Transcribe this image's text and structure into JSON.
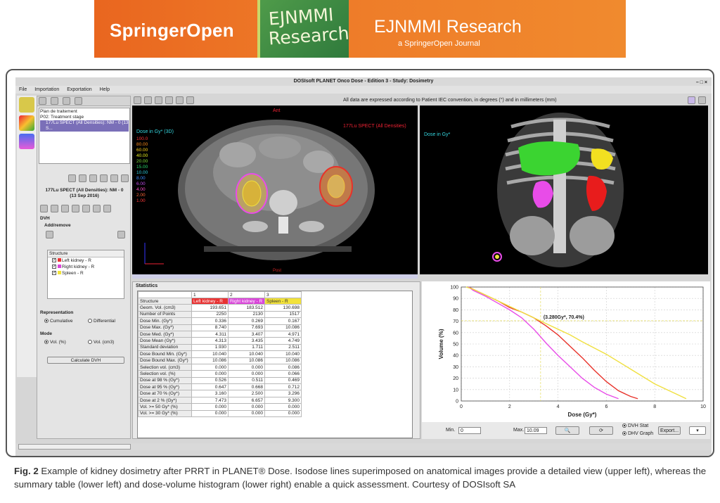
{
  "banner": {
    "publisher": "SpringerOpen",
    "logo_line1": "EJNMMI",
    "logo_line2": "Research",
    "journal": "EJNMMI Research",
    "journal_sub": "a SpringerOpen Journal"
  },
  "window": {
    "title": "DOSIsoft PLANET Onco Dose - Edition 3 - Study: Dosimetry",
    "menu": [
      "File",
      "Importation",
      "Exportation",
      "Help"
    ],
    "info_text": "All data are expressed according to Patient IEC convention, in degrees (°) and in millimeters (mm)"
  },
  "left_panel": {
    "tree": [
      "Plan de traitement",
      "P02: Treatment stage"
    ],
    "tree_selected": "177Lu SPECT (All Densities): NM - 0 (13 S...",
    "study_line1": "177Lu SPECT (All Densities): NM - 0",
    "study_line2": "(13 Sep 2016)",
    "dvh_title": "DVH",
    "add_remove": "Add/remove",
    "structure_header": "Structure",
    "structures": [
      "Left kidney - R",
      "Right kidney - R",
      "Spleen - R"
    ],
    "representation_title": "Representation",
    "cumulative": "Cumulative",
    "differential": "Differential",
    "mode_title": "Mode",
    "vol_pct": "Vol. (%)",
    "vol_cm3": "Vol. (cm3)",
    "calculate_btn": "Calculate DVH"
  },
  "ct_view": {
    "dose_title": "Dose in Gy* (3D)",
    "legend": [
      {
        "v": "100.0",
        "c": "#ff3333"
      },
      {
        "v": "80.00",
        "c": "#ff8c1a"
      },
      {
        "v": "60.00",
        "c": "#ffd21a"
      },
      {
        "v": "40.00",
        "c": "#e8f020"
      },
      {
        "v": "20.00",
        "c": "#7ee03a"
      },
      {
        "v": "15.00",
        "c": "#2bd96b"
      },
      {
        "v": "10.00",
        "c": "#2fcfe0"
      },
      {
        "v": "8.00",
        "c": "#3a8cff"
      },
      {
        "v": "6.00",
        "c": "#c04be8"
      },
      {
        "v": "4.00",
        "c": "#ff4fcf"
      },
      {
        "v": "2.00",
        "c": "#ff6a3a"
      },
      {
        "v": "1.00",
        "c": "#ff3a3a"
      }
    ],
    "ant": "Ant",
    "spect": "177Lu SPECT (All Densities)",
    "post": "Post"
  },
  "vr_view": {
    "dose_title": "Dose in Gy*"
  },
  "statistics": {
    "title": "Statistics",
    "col_numbers": [
      "1",
      "2",
      "3"
    ],
    "header": [
      "Structure",
      "Left kidney - R",
      "Right kidney - R",
      "Spleen - R"
    ],
    "rows": [
      [
        "Geom. Vol. (cm3)",
        "193.651",
        "183.512",
        "130.698"
      ],
      [
        "Number of Points",
        "2250",
        "2130",
        "1517"
      ],
      [
        "Dose Min. (Gy*)",
        "0.336",
        "0.269",
        "0.167"
      ],
      [
        "Dose Max. (Gy*)",
        "8.740",
        "7.693",
        "10.086"
      ],
      [
        "Dose Med. (Gy*)",
        "4.311",
        "3.407",
        "4.971"
      ],
      [
        "Dose Mean (Gy*)",
        "4.313",
        "3.435",
        "4.749"
      ],
      [
        "Standard deviation",
        "1.930",
        "1.711",
        "2.511"
      ],
      [
        "Dose Bound Min. (Gy*)",
        "10.040",
        "10.040",
        "10.040"
      ],
      [
        "Dose Bound Max. (Gy*)",
        "10.086",
        "10.086",
        "10.086"
      ],
      [
        "Selection vol. (cm3)",
        "0.000",
        "0.000",
        "0.086"
      ],
      [
        "Selection vol. (%)",
        "0.000",
        "0.000",
        "0.066"
      ],
      [
        "Dose at 98 % (Gy*)",
        "0.526",
        "0.511",
        "0.469"
      ],
      [
        "Dose at 95 % (Gy*)",
        "0.647",
        "0.668",
        "0.712"
      ],
      [
        "Dose at 70 % (Gy*)",
        "3.160",
        "2.500",
        "3.296"
      ],
      [
        "Dose at 2 % (Gy*)",
        "7.473",
        "6.657",
        "9.300"
      ],
      [
        "Vol. >= 50 Gy* (%)",
        "0.000",
        "0.000",
        "0.000"
      ],
      [
        "Vol. >= 30 Gy* (%)",
        "0.000",
        "0.000",
        "0.000"
      ]
    ]
  },
  "dvh": {
    "min_label": "Min.",
    "min_value": "0",
    "max_label": "Max.",
    "max_value": "10.09",
    "dvh_stat": "DVH Stat",
    "dhv_graph": "DHV Graph",
    "export_btn": "Export..."
  },
  "chart_data": {
    "type": "line",
    "xlabel": "Dose (Gy*)",
    "ylabel": "Volume (%)",
    "xlim": [
      0,
      10
    ],
    "ylim": [
      0,
      100
    ],
    "xticks": [
      0,
      2,
      4,
      6,
      8,
      10
    ],
    "yticks": [
      0,
      10,
      20,
      30,
      40,
      50,
      60,
      70,
      80,
      90,
      100
    ],
    "annotation": "(3.280Gy*, 70.4%)",
    "annotation_point": [
      3.28,
      70.4
    ],
    "grid": true,
    "series": [
      {
        "color": "#e8322a",
        "x": [
          0.3,
          0.5,
          1.0,
          1.5,
          2.0,
          2.5,
          3.0,
          3.5,
          4.0,
          4.5,
          5.0,
          5.5,
          6.0,
          6.5,
          7.0,
          7.3
        ],
        "y": [
          100,
          98,
          93,
          88,
          82,
          78,
          73,
          66,
          58,
          48,
          38,
          27,
          17,
          9,
          4,
          2
        ]
      },
      {
        "color": "#e84ce8",
        "x": [
          0.3,
          0.5,
          1.0,
          1.5,
          2.0,
          2.5,
          3.0,
          3.5,
          4.0,
          4.5,
          5.0,
          5.5,
          6.0,
          6.5
        ],
        "y": [
          100,
          97,
          92,
          86,
          80,
          73,
          63,
          51,
          40,
          30,
          20,
          12,
          6,
          2
        ]
      },
      {
        "color": "#f0e040",
        "x": [
          0.2,
          0.5,
          1.0,
          1.5,
          2.0,
          2.5,
          3.0,
          3.5,
          4.0,
          4.5,
          5.0,
          6.0,
          7.0,
          8.0,
          9.0,
          9.3
        ],
        "y": [
          100,
          98,
          93,
          88,
          83,
          78,
          73,
          68,
          63,
          58,
          52,
          41,
          28,
          15,
          5,
          2
        ]
      }
    ]
  },
  "caption": {
    "fig": "Fig. 2",
    "text": " Example of kidney dosimetry after PRRT in PLANET® Dose. Isodose lines superimposed on anatomical images provide a detailed view (upper left), whereas the summary table (lower left) and dose-volume histogram (lower right) enable a quick assessment. Courtesy of DOSIsoft SA"
  }
}
